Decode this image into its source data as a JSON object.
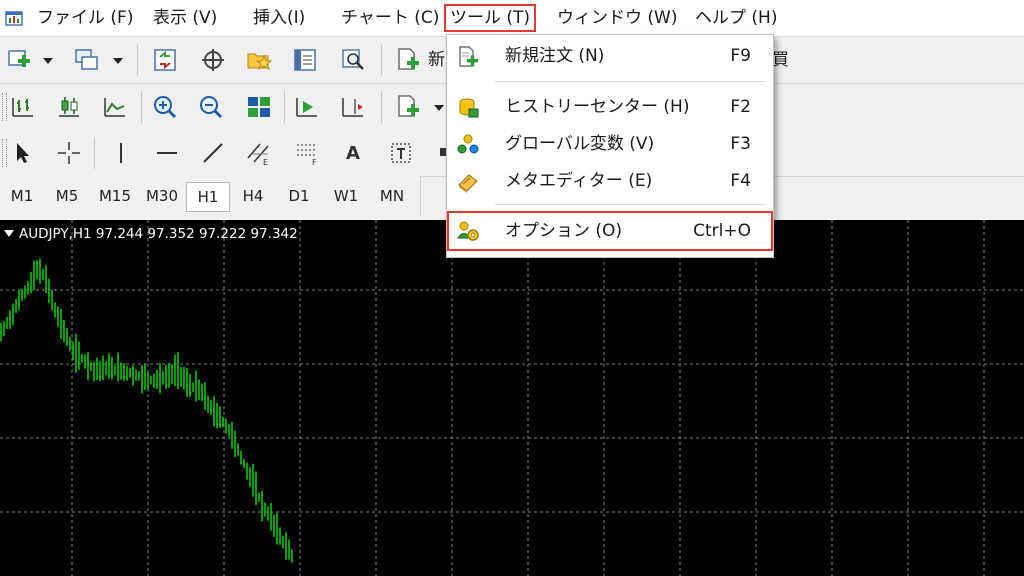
{
  "menubar": {
    "items": [
      {
        "label": "ファイル (F)"
      },
      {
        "label": "表示 (V)"
      },
      {
        "label": "挿入(I)"
      },
      {
        "label": "チャート (C)"
      },
      {
        "label": "ツール (T)"
      },
      {
        "label": "ウィンドウ (W)"
      },
      {
        "label": "ヘルプ (H)"
      }
    ]
  },
  "toolbar": {
    "new_order_label": "新",
    "partial_label": "買",
    "text_tool_label": "A"
  },
  "timeframes": {
    "items": [
      "M1",
      "M5",
      "M15",
      "M30",
      "H1",
      "H4",
      "D1",
      "W1",
      "MN"
    ],
    "selected": "H1"
  },
  "chart": {
    "title": "AUDJPY,H1  97.244 97.352 97.222 97.342",
    "background": "#000000",
    "candle_color": "#00c800",
    "grid_color": "#7f7f7f"
  },
  "tools_menu": {
    "items": [
      {
        "label": "新規注文 (N)",
        "shortcut": "F9",
        "icon": "new-order-icon"
      },
      {
        "label": "ヒストリーセンター (H)",
        "shortcut": "F2",
        "icon": "history-center-icon"
      },
      {
        "label": "グローバル変数 (V)",
        "shortcut": "F3",
        "icon": "global-variables-icon"
      },
      {
        "label": "メタエディター (E)",
        "shortcut": "F4",
        "icon": "metaeditor-icon"
      },
      {
        "label": "オプション (O)",
        "shortcut": "Ctrl+O",
        "icon": "options-icon"
      }
    ],
    "highlight_color": "#e53935"
  }
}
